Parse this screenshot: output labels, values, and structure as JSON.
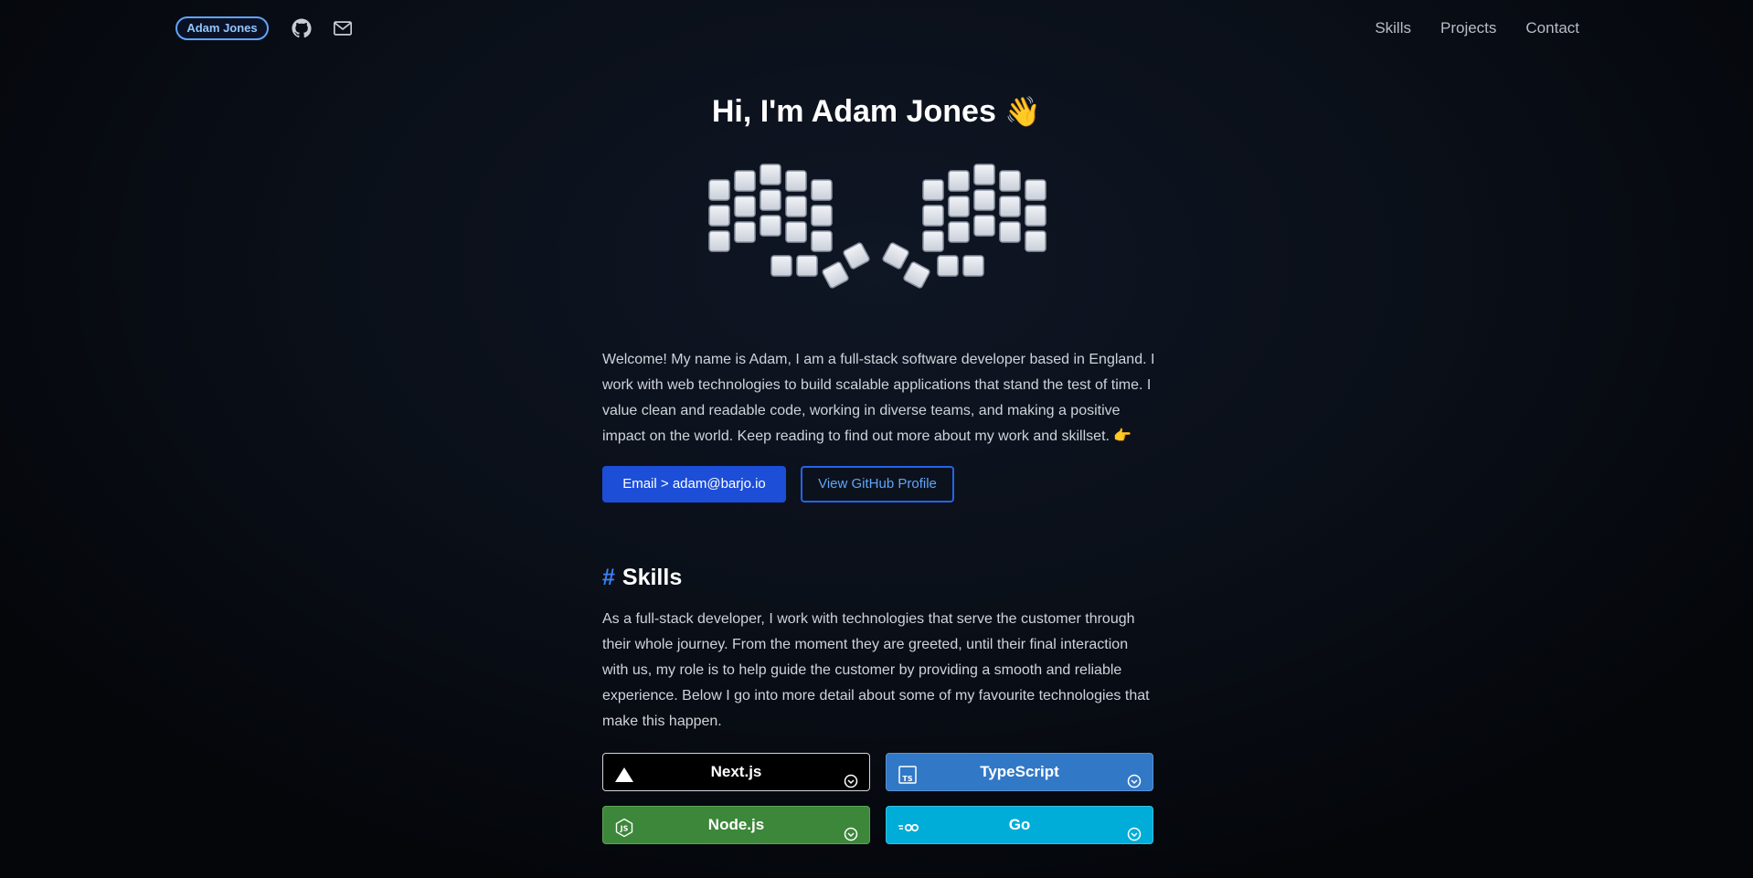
{
  "nav": {
    "brand": "Adam Jones",
    "links": [
      "Skills",
      "Projects",
      "Contact"
    ]
  },
  "hero": {
    "title": "Hi, I'm Adam Jones",
    "wave_emoji": "👋",
    "intro": "Welcome! My name is Adam, I am a full-stack software developer based in England. I work with web technologies to build scalable applications that stand the test of time. I value clean and readable code, working in diverse teams, and making a positive impact on the world. Keep reading to find out more about my work and skillset. 👉",
    "email_button": "Email > adam@barjo.io",
    "github_button": "View GitHub Profile"
  },
  "skills": {
    "hash": "#",
    "title": "Skills",
    "intro": "As a full-stack developer, I work with technologies that serve the customer through their whole journey. From the moment they are greeted, until their final interaction with us, my role is to help guide the customer by providing a smooth and reliable experience. Below I go into more detail about some of my favourite technologies that make this happen.",
    "cards": [
      {
        "label": "Next.js",
        "icon": "nextjs-triangle-icon",
        "bg": "#000000",
        "border": "#d1d5db"
      },
      {
        "label": "TypeScript",
        "icon": "typescript-icon",
        "bg": "#3178c6",
        "border": "#5a93d6"
      },
      {
        "label": "Node.js",
        "icon": "nodejs-icon",
        "bg": "#3c873a",
        "border": "#5aa657"
      },
      {
        "label": "Go",
        "icon": "go-icon",
        "bg": "#00add8",
        "border": "#33c1e4"
      }
    ]
  },
  "colors": {
    "accent": "#3b82f6",
    "primary_button": "#1d4ed8",
    "background": "#0a0f18"
  }
}
